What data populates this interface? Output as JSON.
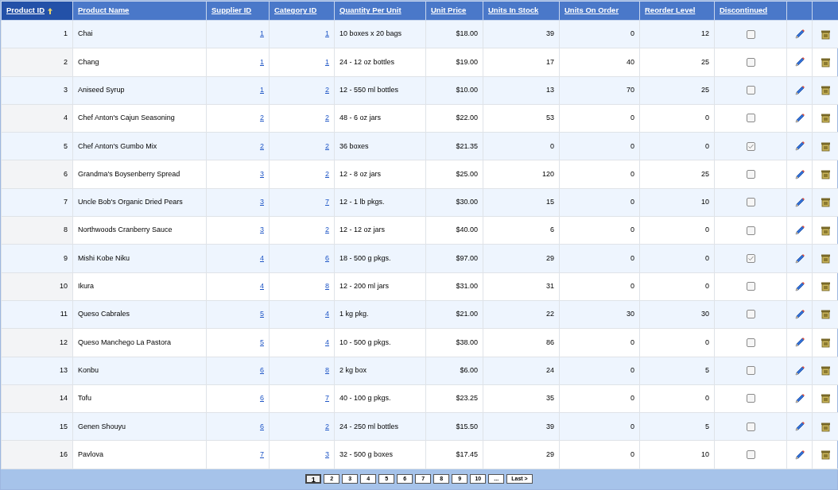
{
  "table": {
    "columns": [
      {
        "label": "Product ID",
        "sorted": true
      },
      {
        "label": "Product Name",
        "sorted": false
      },
      {
        "label": "Supplier ID",
        "sorted": false
      },
      {
        "label": "Category ID",
        "sorted": false
      },
      {
        "label": "Quantity Per Unit",
        "sorted": false
      },
      {
        "label": "Unit Price",
        "sorted": false
      },
      {
        "label": "Units In Stock",
        "sorted": false
      },
      {
        "label": "Units On Order",
        "sorted": false
      },
      {
        "label": "Reorder Level",
        "sorted": false
      },
      {
        "label": "Discontinued",
        "sorted": false
      }
    ],
    "rows": [
      {
        "id": "1",
        "name": "Chai",
        "supplier": "1",
        "category": "1",
        "quantity": "10 boxes x 20 bags",
        "price": "$18.00",
        "stock": "39",
        "on_order": "0",
        "reorder": "12",
        "discontinued": false
      },
      {
        "id": "2",
        "name": "Chang",
        "supplier": "1",
        "category": "1",
        "quantity": "24 - 12 oz bottles",
        "price": "$19.00",
        "stock": "17",
        "on_order": "40",
        "reorder": "25",
        "discontinued": false
      },
      {
        "id": "3",
        "name": "Aniseed Syrup",
        "supplier": "1",
        "category": "2",
        "quantity": "12 - 550 ml bottles",
        "price": "$10.00",
        "stock": "13",
        "on_order": "70",
        "reorder": "25",
        "discontinued": false
      },
      {
        "id": "4",
        "name": "Chef Anton's Cajun Seasoning",
        "supplier": "2",
        "category": "2",
        "quantity": "48 - 6 oz jars",
        "price": "$22.00",
        "stock": "53",
        "on_order": "0",
        "reorder": "0",
        "discontinued": false
      },
      {
        "id": "5",
        "name": "Chef Anton's Gumbo Mix",
        "supplier": "2",
        "category": "2",
        "quantity": "36 boxes",
        "price": "$21.35",
        "stock": "0",
        "on_order": "0",
        "reorder": "0",
        "discontinued": true
      },
      {
        "id": "6",
        "name": "Grandma's Boysenberry Spread",
        "supplier": "3",
        "category": "2",
        "quantity": "12 - 8 oz jars",
        "price": "$25.00",
        "stock": "120",
        "on_order": "0",
        "reorder": "25",
        "discontinued": false
      },
      {
        "id": "7",
        "name": "Uncle Bob's Organic Dried Pears",
        "supplier": "3",
        "category": "7",
        "quantity": "12 - 1 lb pkgs.",
        "price": "$30.00",
        "stock": "15",
        "on_order": "0",
        "reorder": "10",
        "discontinued": false
      },
      {
        "id": "8",
        "name": "Northwoods Cranberry Sauce",
        "supplier": "3",
        "category": "2",
        "quantity": "12 - 12 oz jars",
        "price": "$40.00",
        "stock": "6",
        "on_order": "0",
        "reorder": "0",
        "discontinued": false
      },
      {
        "id": "9",
        "name": "Mishi Kobe Niku",
        "supplier": "4",
        "category": "6",
        "quantity": "18 - 500 g pkgs.",
        "price": "$97.00",
        "stock": "29",
        "on_order": "0",
        "reorder": "0",
        "discontinued": true
      },
      {
        "id": "10",
        "name": "Ikura",
        "supplier": "4",
        "category": "8",
        "quantity": "12 - 200 ml jars",
        "price": "$31.00",
        "stock": "31",
        "on_order": "0",
        "reorder": "0",
        "discontinued": false
      },
      {
        "id": "11",
        "name": "Queso Cabrales",
        "supplier": "5",
        "category": "4",
        "quantity": "1 kg pkg.",
        "price": "$21.00",
        "stock": "22",
        "on_order": "30",
        "reorder": "30",
        "discontinued": false
      },
      {
        "id": "12",
        "name": "Queso Manchego La Pastora",
        "supplier": "5",
        "category": "4",
        "quantity": "10 - 500 g pkgs.",
        "price": "$38.00",
        "stock": "86",
        "on_order": "0",
        "reorder": "0",
        "discontinued": false
      },
      {
        "id": "13",
        "name": "Konbu",
        "supplier": "6",
        "category": "8",
        "quantity": "2 kg box",
        "price": "$6.00",
        "stock": "24",
        "on_order": "0",
        "reorder": "5",
        "discontinued": false
      },
      {
        "id": "14",
        "name": "Tofu",
        "supplier": "6",
        "category": "7",
        "quantity": "40 - 100 g pkgs.",
        "price": "$23.25",
        "stock": "35",
        "on_order": "0",
        "reorder": "0",
        "discontinued": false
      },
      {
        "id": "15",
        "name": "Genen Shouyu",
        "supplier": "6",
        "category": "2",
        "quantity": "24 - 250 ml bottles",
        "price": "$15.50",
        "stock": "39",
        "on_order": "0",
        "reorder": "5",
        "discontinued": false
      },
      {
        "id": "16",
        "name": "Pavlova",
        "supplier": "7",
        "category": "3",
        "quantity": "32 - 500 g boxes",
        "price": "$17.45",
        "stock": "29",
        "on_order": "0",
        "reorder": "10",
        "discontinued": false
      }
    ]
  },
  "pager": [
    {
      "label": "1",
      "selected": true
    },
    {
      "label": "2",
      "selected": false
    },
    {
      "label": "3",
      "selected": false
    },
    {
      "label": "4",
      "selected": false
    },
    {
      "label": "5",
      "selected": false
    },
    {
      "label": "6",
      "selected": false
    },
    {
      "label": "7",
      "selected": false
    },
    {
      "label": "8",
      "selected": false
    },
    {
      "label": "9",
      "selected": false
    },
    {
      "label": "10",
      "selected": false
    },
    {
      "label": "...",
      "selected": false
    },
    {
      "label": "Last >",
      "selected": false
    }
  ]
}
